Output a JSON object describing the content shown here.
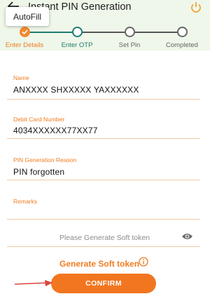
{
  "header": {
    "title": "Instant PIN Generation",
    "back_icon": "arrow-left-icon",
    "power_icon": "power-icon"
  },
  "autofill": {
    "label": "AutoFill"
  },
  "stepper": {
    "steps": [
      {
        "label": "Enter Details",
        "state": "completed"
      },
      {
        "label": "Enter OTP",
        "state": "current"
      },
      {
        "label": "Set Pin",
        "state": "pending"
      },
      {
        "label": "Completed",
        "state": "pending"
      }
    ]
  },
  "form": {
    "name": {
      "label": "Name",
      "value": "ANXXXX SHXXXXX YAXXXXXX"
    },
    "debit_card": {
      "label": "Debit Card Number",
      "value": "4034XXXXXX77XX77"
    },
    "reason": {
      "label": "PIN Generation Reason",
      "value": "PIN forgotten"
    },
    "remarks": {
      "label": "Remarks",
      "value": ""
    },
    "soft_token": {
      "placeholder": "Please Generate Soft token",
      "icon": "eye-icon"
    }
  },
  "generate_token": {
    "label": "Generate Soft token",
    "icon": "info-icon"
  },
  "confirm": {
    "label": "CONFIRM"
  },
  "colors": {
    "accent": "#ef7d22",
    "green": "#1e7a6f",
    "header_bg": "#eef7e9",
    "pending": "#666666"
  }
}
